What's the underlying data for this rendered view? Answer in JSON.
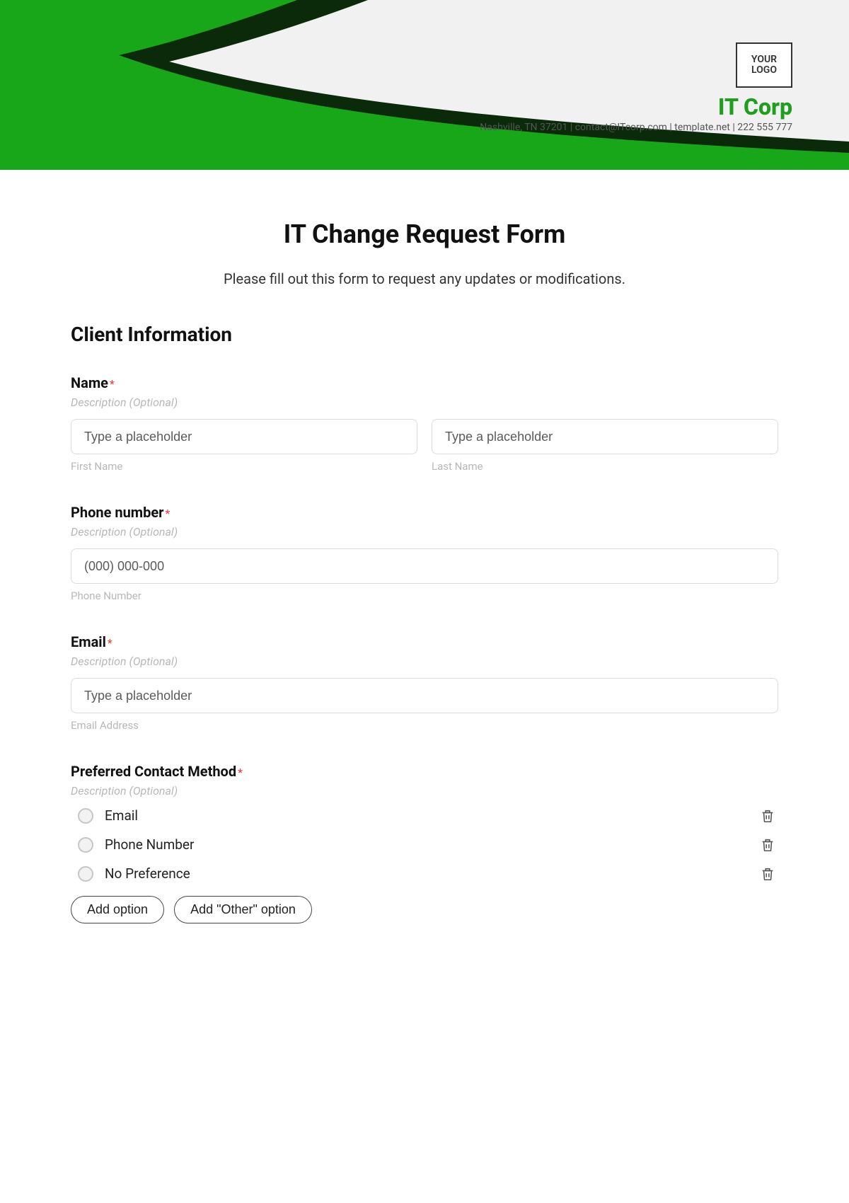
{
  "header": {
    "logo_text": "YOUR\nLOGO",
    "company": "IT Corp",
    "contact_line": "Nashville, TN 37201 | contact@ITcorp.com | template.net | 222 555 777"
  },
  "form": {
    "title": "IT Change Request Form",
    "subtitle": "Please fill out this form to request any updates or modifications.",
    "section_heading": "Client Information",
    "description_placeholder": "Description (Optional)",
    "name": {
      "label": "Name",
      "first_placeholder": "Type a placeholder",
      "first_sublabel": "First Name",
      "last_placeholder": "Type a placeholder",
      "last_sublabel": "Last Name"
    },
    "phone": {
      "label": "Phone number",
      "placeholder": "(000) 000-000",
      "sublabel": "Phone Number"
    },
    "email": {
      "label": "Email",
      "placeholder": "Type a placeholder",
      "sublabel": "Email Address"
    },
    "contact_method": {
      "label": "Preferred Contact Method",
      "options": [
        "Email",
        "Phone Number",
        "No Preference"
      ],
      "add_option": "Add option",
      "add_other": "Add \"Other\" option"
    }
  }
}
